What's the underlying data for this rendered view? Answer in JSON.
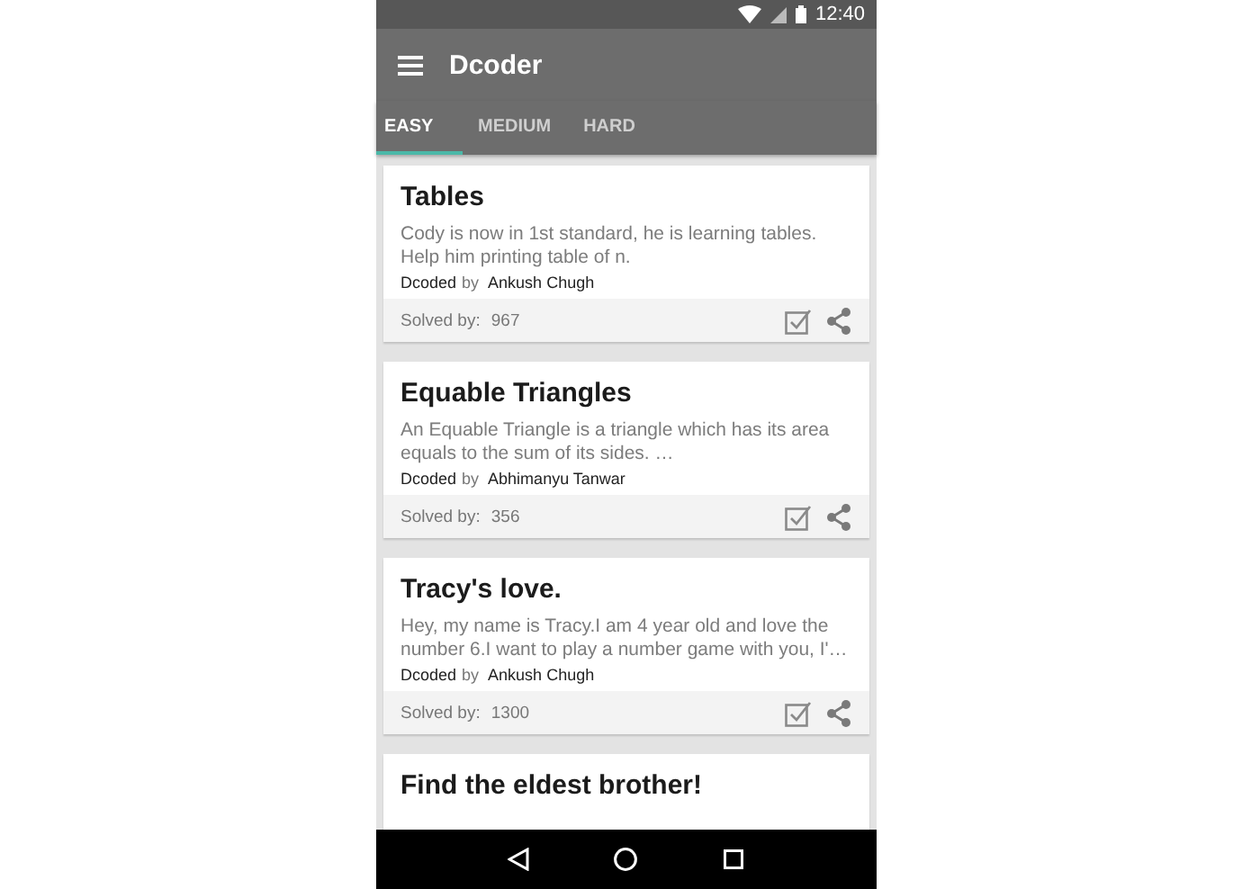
{
  "status_bar": {
    "time": "12:40"
  },
  "app_bar": {
    "title": "Dcoder"
  },
  "tabs": [
    {
      "label": "EASY",
      "selected": true
    },
    {
      "label": "MEDIUM",
      "selected": false
    },
    {
      "label": "HARD",
      "selected": false
    }
  ],
  "problems": [
    {
      "title": "Tables",
      "description": "Cody is now in 1st standard, he is learning tables. Help him printing table of n.",
      "coded_label": "Dcoded",
      "by_label": "by",
      "author": "Ankush Chugh",
      "solved_label": "Solved by:",
      "solved_count": "967"
    },
    {
      "title": "Equable Triangles",
      "description": "An Equable Triangle is a triangle which has its area equals to the sum of its sides. …",
      "coded_label": "Dcoded",
      "by_label": "by",
      "author": "Abhimanyu Tanwar",
      "solved_label": "Solved by:",
      "solved_count": "356"
    },
    {
      "title": "Tracy's love.",
      "description": "Hey, my name is Tracy.I am 4 year old and love the number 6.I want to play a number game with you, I'…",
      "coded_label": "Dcoded",
      "by_label": "by",
      "author": "Ankush Chugh",
      "solved_label": "Solved by:",
      "solved_count": "1300"
    },
    {
      "title": "Find the eldest brother!"
    }
  ]
}
